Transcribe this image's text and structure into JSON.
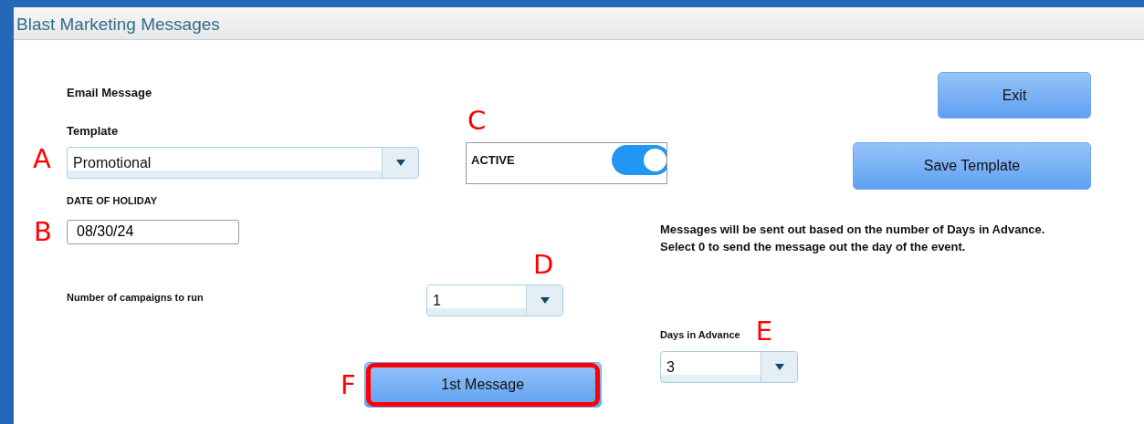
{
  "window": {
    "title": "Blast Marketing Messages"
  },
  "section_label": "Email Message",
  "template": {
    "label": "Template",
    "value": "Promotional"
  },
  "date_of_holiday": {
    "label": "DATE OF HOLIDAY",
    "value": "08/30/24"
  },
  "status_toggle": {
    "label": "ACTIVE",
    "on": true
  },
  "campaigns": {
    "label": "Number of campaigns to run",
    "value": "1"
  },
  "message_button": {
    "label": "1st Message",
    "highlighted": true
  },
  "buttons": [
    {
      "label": "Exit"
    },
    {
      "label": "Save Template"
    }
  ],
  "info_text": "Messages will be sent out based on the number of Days in Advance. Select 0 to send the message out the day of the event.",
  "days_in_advance": {
    "label": "Days in Advance",
    "value": "3"
  },
  "callouts": [
    "A",
    "B",
    "C",
    "D",
    "E",
    "F"
  ]
}
